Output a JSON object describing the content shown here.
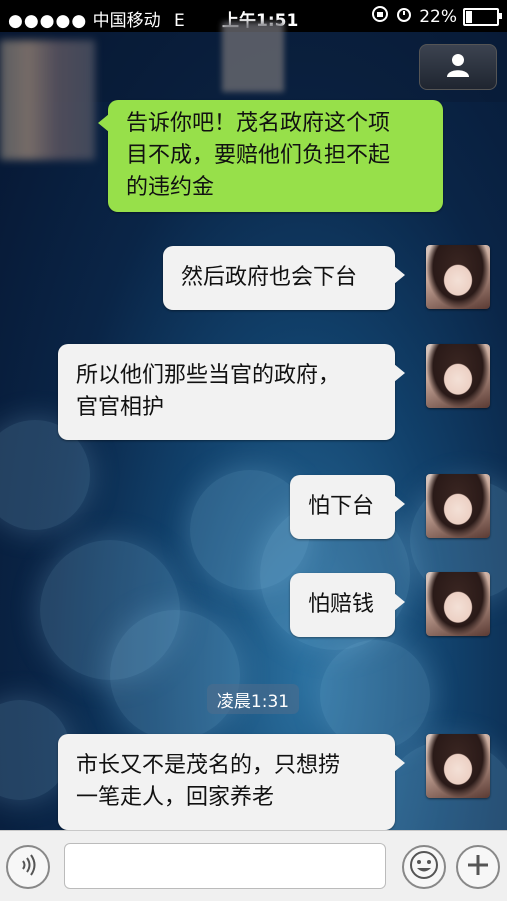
{
  "status_bar": {
    "signal_dots": "●●●●●",
    "carrier": "中国移动",
    "network": "E",
    "time": "上午1:51",
    "battery": "22%",
    "battery_level": 0.22
  },
  "chat": {
    "messages": [
      {
        "side": "left",
        "text_lines": [
          "告诉你吧！茂名政府这个项",
          "目不成，要赔他们负担不起",
          "的违约金"
        ]
      },
      {
        "side": "right",
        "text_lines": [
          "然后政府也会下台"
        ]
      },
      {
        "side": "right",
        "text_lines": [
          "所以他们那些当官的政府，",
          "官官相护"
        ]
      },
      {
        "side": "right",
        "text_lines": [
          "怕下台"
        ]
      },
      {
        "side": "right",
        "text_lines": [
          "怕赔钱"
        ]
      },
      {
        "side": "right",
        "text_lines": [
          "市长又不是茂名的，只想捞",
          "一笔走人，回家养老"
        ]
      }
    ],
    "timestamp": "凌晨1:31"
  },
  "toolbar": {
    "voice_icon": "voice-icon",
    "emoji_icon": "emoji-icon",
    "plus_icon": "plus-icon",
    "input_value": ""
  },
  "colors": {
    "outgoing_bubble": "#97e04a",
    "incoming_bubble": "#f2f2f2"
  }
}
